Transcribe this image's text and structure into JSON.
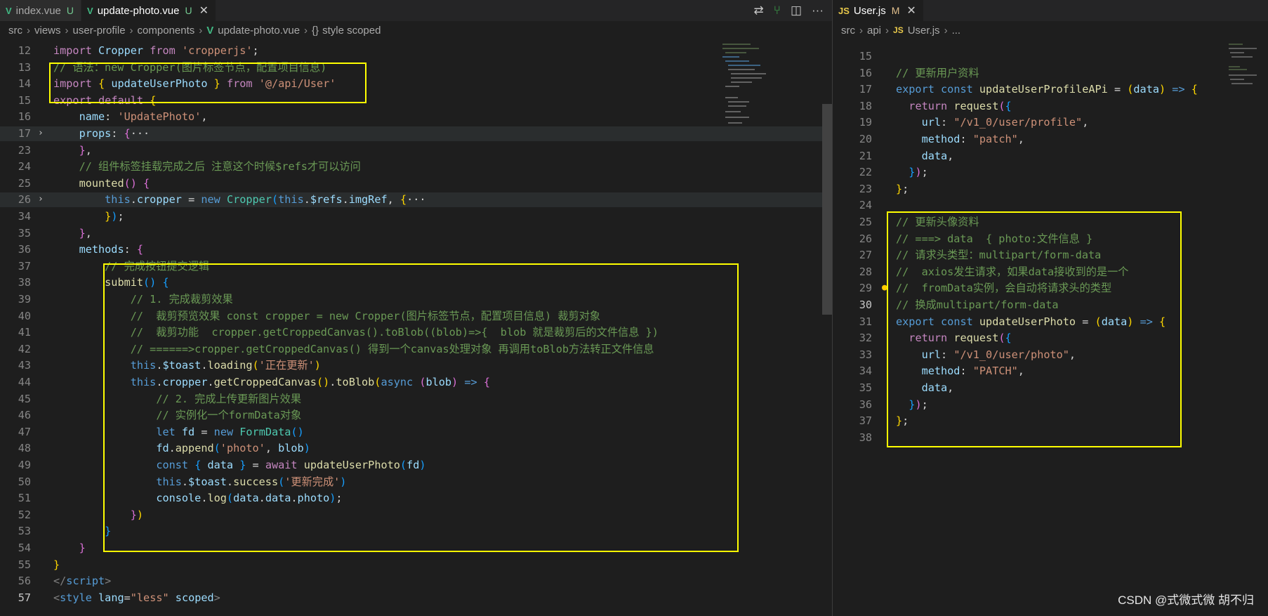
{
  "left": {
    "tabs": [
      {
        "label": "index.vue",
        "status": "U",
        "icon": "vue-icon",
        "active": false
      },
      {
        "label": "update-photo.vue",
        "status": "U",
        "icon": "vue-icon",
        "active": true
      }
    ],
    "breadcrumb": [
      "src",
      "views",
      "user-profile",
      "components",
      "update-photo.vue",
      "style scoped"
    ],
    "lines": [
      {
        "n": "12",
        "html": "<span class='kc'>import</span> <span class='v'>Cropper</span> <span class='kc'>from</span> <span class='s'>'cropperjs'</span><span class='p'>;</span>"
      },
      {
        "n": "13",
        "html": "<span class='c'>// 语法：new Cropper(图片标签节点，配置项目信息)</span>"
      },
      {
        "n": "14",
        "html": "<span class='kc'>import</span> <span class='b1'>{</span> <span class='v'>updateUserPhoto</span> <span class='b1'>}</span> <span class='kc'>from</span> <span class='s'>'@/api/User'</span>"
      },
      {
        "n": "15",
        "html": "<span class='kc'>export</span> <span class='kc'>default</span> <span class='b1'>{</span>"
      },
      {
        "n": "16",
        "html": "    <span class='v'>name</span><span class='p'>:</span> <span class='s'>'UpdatePhoto'</span><span class='p'>,</span>"
      },
      {
        "n": "17",
        "fold": true,
        "highlight": true,
        "html": "    <span class='v'>props</span><span class='p'>:</span> <span class='b2'>{</span><span class='p'>···</span>"
      },
      {
        "n": "23",
        "html": "    <span class='b2'>}</span><span class='p'>,</span>"
      },
      {
        "n": "24",
        "html": "    <span class='c'>// 组件标签挂载完成之后 注意这个时候$refs才可以访问</span>"
      },
      {
        "n": "25",
        "html": "    <span class='f'>mounted</span><span class='b2'>()</span> <span class='b2'>{</span>"
      },
      {
        "n": "26",
        "fold": true,
        "highlight": true,
        "html": "        <span class='k'>this</span><span class='p'>.</span><span class='v'>cropper</span> <span class='p'>=</span> <span class='k'>new</span> <span class='t'>Cropper</span><span class='b3'>(</span><span class='k'>this</span><span class='p'>.</span><span class='v'>$refs</span><span class='p'>.</span><span class='v'>imgRef</span><span class='p'>,</span> <span class='b1'>{</span><span class='p'>···</span>"
      },
      {
        "n": "34",
        "html": "        <span class='b1'>}</span><span class='b3'>)</span><span class='p'>;</span>"
      },
      {
        "n": "35",
        "html": "    <span class='b2'>}</span><span class='p'>,</span>"
      },
      {
        "n": "36",
        "html": "    <span class='v'>methods</span><span class='p'>:</span> <span class='b2'>{</span>"
      },
      {
        "n": "37",
        "html": "        <span class='c'>// 完成按钮提交逻辑</span>"
      },
      {
        "n": "38",
        "html": "        <span class='f'>submit</span><span class='b3'>()</span> <span class='b3'>{</span>"
      },
      {
        "n": "39",
        "html": "            <span class='c'>// 1. 完成裁剪效果</span>"
      },
      {
        "n": "40",
        "html": "            <span class='c'>//  裁剪预览效果 const cropper = new Cropper(图片标签节点，配置项目信息) 裁剪对象</span>"
      },
      {
        "n": "41",
        "html": "            <span class='c'>//  裁剪功能  cropper.getCroppedCanvas().toBlob((blob)=>{  blob 就是裁剪后的文件信息 })</span>"
      },
      {
        "n": "42",
        "html": "            <span class='c'>// ======>cropper.getCroppedCanvas() 得到一个canvas处理对象 再调用toBlob方法转正文件信息</span>"
      },
      {
        "n": "43",
        "html": "            <span class='k'>this</span><span class='p'>.</span><span class='v'>$toast</span><span class='p'>.</span><span class='f'>loading</span><span class='b1'>(</span><span class='s'>'正在更新'</span><span class='b1'>)</span>"
      },
      {
        "n": "44",
        "html": "            <span class='k'>this</span><span class='p'>.</span><span class='v'>cropper</span><span class='p'>.</span><span class='f'>getCroppedCanvas</span><span class='b1'>()</span><span class='p'>.</span><span class='f'>toBlob</span><span class='b1'>(</span><span class='k'>async</span> <span class='b2'>(</span><span class='v'>blob</span><span class='b2'>)</span> <span class='k'>=&gt;</span> <span class='b2'>{</span>"
      },
      {
        "n": "45",
        "html": "                <span class='c'>// 2. 完成上传更新图片效果</span>"
      },
      {
        "n": "46",
        "html": "                <span class='c'>// 实例化一个formData对象</span>"
      },
      {
        "n": "47",
        "html": "                <span class='k'>let</span> <span class='v'>fd</span> <span class='p'>=</span> <span class='k'>new</span> <span class='t'>FormData</span><span class='b3'>()</span>"
      },
      {
        "n": "48",
        "html": "                <span class='v'>fd</span><span class='p'>.</span><span class='f'>append</span><span class='b3'>(</span><span class='s'>'photo'</span><span class='p'>,</span> <span class='v'>blob</span><span class='b3'>)</span>"
      },
      {
        "n": "49",
        "html": "                <span class='k'>const</span> <span class='b3'>{</span> <span class='v'>data</span> <span class='b3'>}</span> <span class='p'>=</span> <span class='kc'>await</span> <span class='f'>updateUserPhoto</span><span class='b3'>(</span><span class='v'>fd</span><span class='b3'>)</span>"
      },
      {
        "n": "50",
        "html": "                <span class='k'>this</span><span class='p'>.</span><span class='v'>$toast</span><span class='p'>.</span><span class='f'>success</span><span class='b3'>(</span><span class='s'>'更新完成'</span><span class='b3'>)</span>"
      },
      {
        "n": "51",
        "html": "                <span class='v'>console</span><span class='p'>.</span><span class='f'>log</span><span class='b3'>(</span><span class='v'>data</span><span class='p'>.</span><span class='v'>data</span><span class='p'>.</span><span class='v'>photo</span><span class='b3'>)</span><span class='p'>;</span>"
      },
      {
        "n": "52",
        "html": "            <span class='b2'>}</span><span class='b1'>)</span>"
      },
      {
        "n": "53",
        "html": "        <span class='b3'>}</span>"
      },
      {
        "n": "54",
        "html": "    <span class='b2'>}</span>"
      },
      {
        "n": "55",
        "html": "<span class='b1'>}</span>"
      },
      {
        "n": "56",
        "html": "<span class='tg'>&lt;/</span><span class='k'>script</span><span class='tg'>&gt;</span>"
      },
      {
        "n": "57",
        "current": true,
        "html": "<span class='tg'>&lt;</span><span class='k'>style</span> <span class='v'>lang</span><span class='p'>=</span><span class='s'>\"less\"</span> <span class='v'>scoped</span><span class='tg'>&gt;</span>"
      }
    ]
  },
  "right": {
    "tabs": [
      {
        "label": "User.js",
        "status": "M",
        "icon": "js-icon",
        "active": true
      }
    ],
    "breadcrumb": [
      "src",
      "api",
      "User.js",
      "..."
    ],
    "lines": [
      {
        "n": "15",
        "html": ""
      },
      {
        "n": "16",
        "html": "<span class='c'>// 更新用户资料</span>"
      },
      {
        "n": "17",
        "html": "<span class='k'>export</span> <span class='k'>const</span> <span class='f'>updateUserProfileAPi</span> <span class='p'>=</span> <span class='b1'>(</span><span class='v'>data</span><span class='b1'>)</span> <span class='k'>=&gt;</span> <span class='b1'>{</span>"
      },
      {
        "n": "18",
        "html": "  <span class='kc'>return</span> <span class='f'>request</span><span class='b2'>(</span><span class='b3'>{</span>"
      },
      {
        "n": "19",
        "html": "    <span class='v'>url</span><span class='p'>:</span> <span class='s'>\"/v1_0/user/profile\"</span><span class='p'>,</span>"
      },
      {
        "n": "20",
        "html": "    <span class='v'>method</span><span class='p'>:</span> <span class='s'>\"patch\"</span><span class='p'>,</span>"
      },
      {
        "n": "21",
        "html": "    <span class='v'>data</span><span class='p'>,</span>"
      },
      {
        "n": "22",
        "html": "  <span class='b3'>}</span><span class='b2'>)</span><span class='p'>;</span>"
      },
      {
        "n": "23",
        "html": "<span class='b1'>}</span><span class='p'>;</span>"
      },
      {
        "n": "24",
        "html": ""
      },
      {
        "n": "25",
        "html": "<span class='c'>// 更新头像资料</span>"
      },
      {
        "n": "26",
        "html": "<span class='c'>// ===&gt; data  { photo:文件信息 }</span>"
      },
      {
        "n": "27",
        "html": "<span class='c'>// 请求头类型：multipart/form-data</span>"
      },
      {
        "n": "28",
        "html": "<span class='c'>//  axios发生请求，如果data接收到的是一个</span>"
      },
      {
        "n": "29",
        "bulb": true,
        "html": "<span class='c'>//  fromData实例，会自动将请求头的类型</span>"
      },
      {
        "n": "30",
        "current": true,
        "html": "<span class='c'>// 换成multipart/form-data</span>"
      },
      {
        "n": "31",
        "html": "<span class='k'>export</span> <span class='k'>const</span> <span class='f'>updateUserPhoto</span> <span class='p'>=</span> <span class='b1'>(</span><span class='v'>data</span><span class='b1'>)</span> <span class='k'>=&gt;</span> <span class='b1'>{</span>"
      },
      {
        "n": "32",
        "html": "  <span class='kc'>return</span> <span class='f'>request</span><span class='b2'>(</span><span class='b3'>{</span>"
      },
      {
        "n": "33",
        "html": "    <span class='v'>url</span><span class='p'>:</span> <span class='s'>\"/v1_0/user/photo\"</span><span class='p'>,</span>"
      },
      {
        "n": "34",
        "html": "    <span class='v'>method</span><span class='p'>:</span> <span class='s'>\"PATCH\"</span><span class='p'>,</span>"
      },
      {
        "n": "35",
        "html": "    <span class='v'>data</span><span class='p'>,</span>"
      },
      {
        "n": "36",
        "html": "  <span class='b3'>}</span><span class='b2'>)</span><span class='p'>;</span>"
      },
      {
        "n": "37",
        "html": "<span class='b1'>}</span><span class='p'>;</span>"
      },
      {
        "n": "38",
        "html": ""
      }
    ]
  },
  "watermark": "CSDN @式微式微   胡不归",
  "colors": {
    "highlight_box": "#ffff00",
    "editor_bg": "#1e1e1e",
    "tabbar_bg": "#252526"
  }
}
